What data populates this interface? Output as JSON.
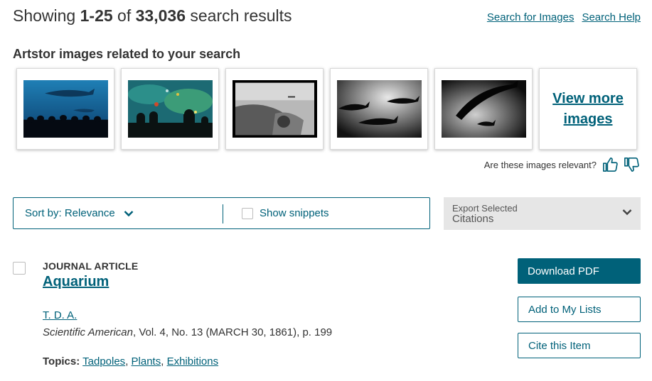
{
  "results": {
    "prefix": "Showing ",
    "range": "1-25",
    "of": " of ",
    "total": "33,036",
    "suffix": " search results"
  },
  "top_links": {
    "search_images": "Search for Images",
    "search_help": "Search Help"
  },
  "artstor": {
    "title": "Artstor images related to your search",
    "view_more_line1": "View more",
    "view_more_line2": "images",
    "relevance_question": "Are these images relevant?"
  },
  "toolbar": {
    "sort_label": "Sort by: Relevance",
    "snippets_label": "Show snippets",
    "export_line1": "Export Selected",
    "export_line2": "Citations"
  },
  "result_item": {
    "type": "JOURNAL ARTICLE",
    "title": "Aquarium",
    "author": "T. D. A.",
    "journal": "Scientific American",
    "citation_rest": ", Vol. 4, No. 13 (MARCH 30, 1861), p. 199",
    "topics_label": "Topics:",
    "topics": [
      "Tadpoles",
      "Plants",
      "Exhibitions"
    ],
    "buttons": {
      "download": "Download PDF",
      "add_lists": "Add to My Lists",
      "cite": "Cite this Item"
    }
  },
  "colors": {
    "accent": "#006179",
    "text": "#333333",
    "export_bg": "#e6e6e6"
  }
}
